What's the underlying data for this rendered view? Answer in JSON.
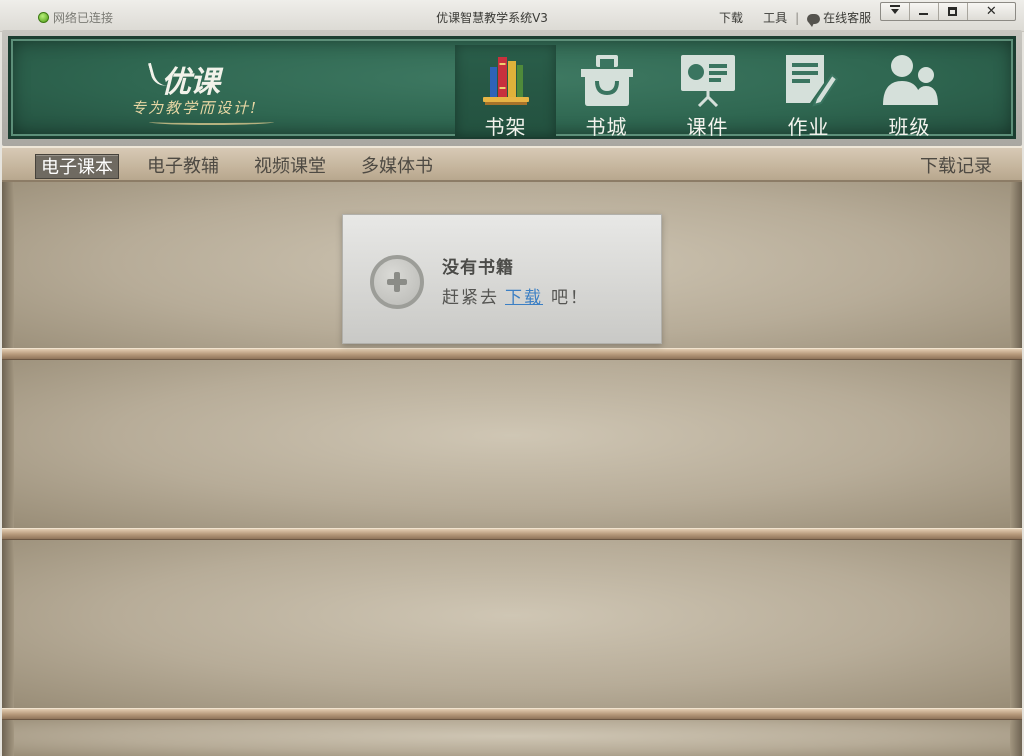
{
  "titlebar": {
    "network_status": "网络已连接",
    "title": "优课智慧教学系统V3",
    "links": {
      "download": "下载",
      "tools": "工具",
      "online_service": "在线客服"
    }
  },
  "header": {
    "logo_text": "优课",
    "slogan": "专为教学而设计!",
    "nav": [
      {
        "label": "书架",
        "icon": "bookshelf-icon",
        "active": true
      },
      {
        "label": "书城",
        "icon": "shopping-bag-icon",
        "active": false
      },
      {
        "label": "课件",
        "icon": "presentation-icon",
        "active": false
      },
      {
        "label": "作业",
        "icon": "homework-icon",
        "active": false
      },
      {
        "label": "班级",
        "icon": "users-icon",
        "active": false
      }
    ]
  },
  "tabs": [
    {
      "label": "电子课本",
      "active": true
    },
    {
      "label": "电子教辅",
      "active": false
    },
    {
      "label": "视频课堂",
      "active": false
    },
    {
      "label": "多媒体书",
      "active": false
    }
  ],
  "download_record": "下载记录",
  "empty_notice": {
    "title": "没有书籍",
    "prefix": "赶紧去",
    "link": "下载",
    "suffix": "吧！"
  },
  "colors": {
    "board_green": "#2f6751",
    "link_blue": "#3b7fc4",
    "active_tab": "#6f6a61"
  }
}
